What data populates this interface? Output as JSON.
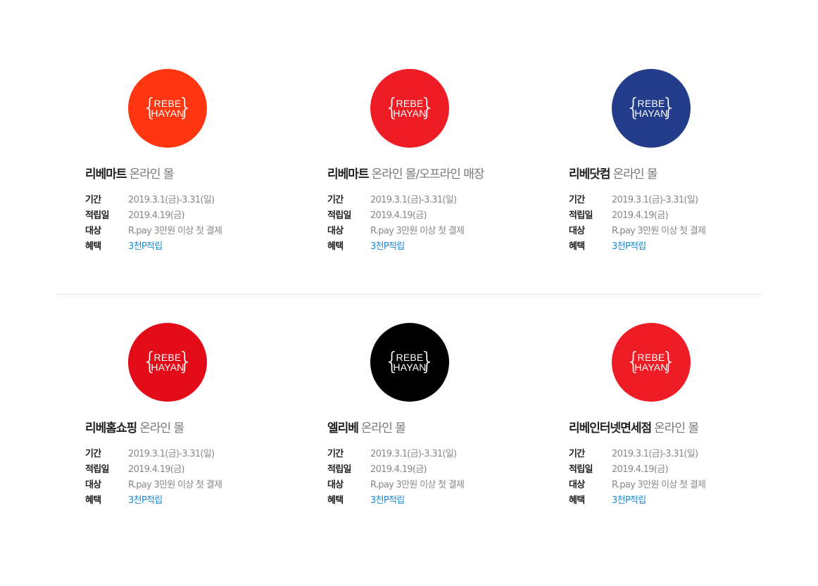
{
  "logo": {
    "word_1": "REBE",
    "word_2": "HAYAN",
    "brace_left": "{",
    "brace_right": "}"
  },
  "labels": {
    "period": "기간",
    "accrual_date": "적립일",
    "target": "대상",
    "benefit": "혜택"
  },
  "cards": [
    {
      "brand": "리베마트",
      "channel": "온라인 몰",
      "logo_color": "#FF3610",
      "period": "2019.3.1(금)-3.31(일)",
      "accrual_date": "2019.4.19(금)",
      "target": "R.pay 3만원 이상 첫 결제",
      "benefit": "3천P적립"
    },
    {
      "brand": "리베마트",
      "channel": "온라인 몰/오프라인 매장",
      "logo_color": "#EE1C25",
      "period": "2019.3.1(금)-3.31(일)",
      "accrual_date": "2019.4.19(금)",
      "target": "R.pay 3만원 이상 첫 결제",
      "benefit": "3천P적립"
    },
    {
      "brand": "리베닷컴",
      "channel": "온라인 몰",
      "logo_color": "#243D8B",
      "period": "2019.3.1(금)-3.31(일)",
      "accrual_date": "2019.4.19(금)",
      "target": "R.pay 3만원 이상 첫 결제",
      "benefit": "3천P적립"
    },
    {
      "brand": "리베홈쇼핑",
      "channel": "온라인 몰",
      "logo_color": "#E30B17",
      "period": "2019.3.1(금)-3.31(일)",
      "accrual_date": "2019.4.19(금)",
      "target": "R.pay 3만원 이상 첫 결제",
      "benefit": "3천P적립"
    },
    {
      "brand": "엘리베",
      "channel": "온라인 몰",
      "logo_color": "#000000",
      "period": "2019.3.1(금)-3.31(일)",
      "accrual_date": "2019.4.19(금)",
      "target": "R.pay 3만원 이상 첫 결제",
      "benefit": "3천P적립"
    },
    {
      "brand": "리베인터넷면세점",
      "channel": "온라인 몰",
      "logo_color": "#EE1C25",
      "period": "2019.3.1(금)-3.31(일)",
      "accrual_date": "2019.4.19(금)",
      "target": "R.pay 3만원 이상 첫 결제",
      "benefit": "3천P적립"
    }
  ]
}
